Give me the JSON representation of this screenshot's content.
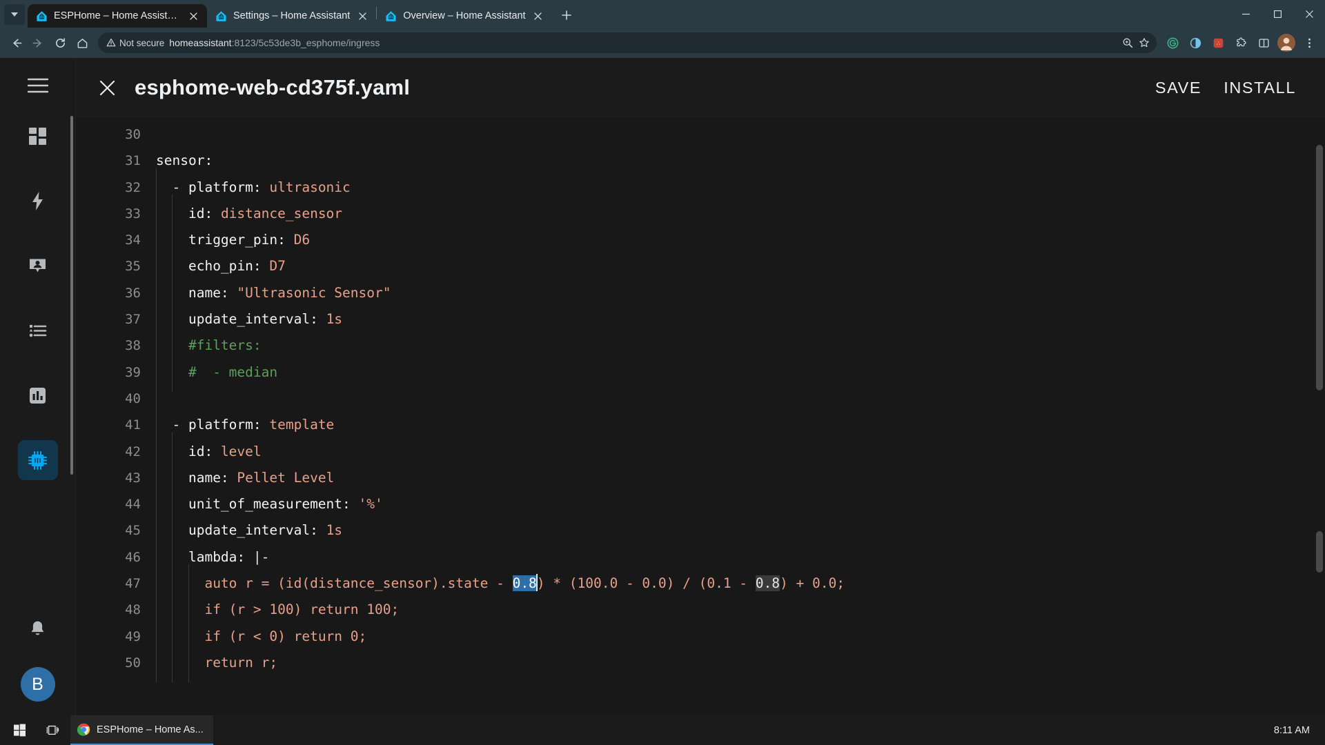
{
  "browser": {
    "tabs": [
      {
        "title": "ESPHome – Home Assistant",
        "active": true,
        "favicon": "home-assistant-icon",
        "closable": true
      },
      {
        "title": "Settings – Home Assistant",
        "active": false,
        "favicon": "home-assistant-icon",
        "closable": true
      },
      {
        "title": "Overview – Home Assistant",
        "active": false,
        "favicon": "home-assistant-icon",
        "closable": true
      }
    ],
    "tab_list_button": "tab-search-chevron",
    "new_tab_label": "+",
    "window_controls": {
      "minimize": "–",
      "maximize": "□",
      "close": "✕"
    },
    "nav": {
      "back": "back-arrow-icon",
      "forward": "forward-arrow-icon",
      "reload": "reload-icon",
      "home": "home-icon"
    },
    "omnibox": {
      "security_label": "Not secure",
      "url_host": "homeassistant",
      "url_rest": ":8123/5c53de3b_esphome/ingress",
      "zoom_icon": "zoom-in-icon",
      "bookmark_icon": "star-icon"
    },
    "toolbar_right": [
      "grammarly-icon",
      "dark-reader-icon",
      "lastpass-icon",
      "extensions-icon",
      "split-screen-icon",
      "profile-avatar",
      "more-menu-icon"
    ]
  },
  "ha_sidebar": {
    "menu_button": "hamburger-menu-icon",
    "items": [
      {
        "name": "overview",
        "icon": "view-dashboard-icon",
        "selected": false
      },
      {
        "name": "energy",
        "icon": "lightning-bolt-icon",
        "selected": false
      },
      {
        "name": "map",
        "icon": "map-marker-account-icon",
        "selected": false
      },
      {
        "name": "logbook",
        "icon": "format-list-bulleted-icon",
        "selected": false
      },
      {
        "name": "history",
        "icon": "chart-box-icon",
        "selected": false
      },
      {
        "name": "esphome",
        "icon": "chip-icon",
        "selected": true
      }
    ],
    "notifications_icon": "bell-icon",
    "user_avatar_initial": "B"
  },
  "editor": {
    "close_icon": "close-icon",
    "filename": "esphome-web-cd375f.yaml",
    "save_label": "SAVE",
    "install_label": "INSTALL",
    "first_line_number": 30,
    "lines": [
      {
        "no": 30,
        "indent": 0,
        "tokens": []
      },
      {
        "no": 31,
        "indent": 0,
        "tokens": [
          {
            "t": "sensor:",
            "c": "k"
          }
        ]
      },
      {
        "no": 32,
        "indent": 1,
        "tokens": [
          {
            "t": "- ",
            "c": "pl"
          },
          {
            "t": "platform: ",
            "c": "k"
          },
          {
            "t": "ultrasonic",
            "c": "v"
          }
        ]
      },
      {
        "no": 33,
        "indent": 2,
        "tokens": [
          {
            "t": "id: ",
            "c": "k"
          },
          {
            "t": "distance_sensor",
            "c": "v"
          }
        ]
      },
      {
        "no": 34,
        "indent": 2,
        "tokens": [
          {
            "t": "trigger_pin: ",
            "c": "k"
          },
          {
            "t": "D6",
            "c": "v"
          }
        ]
      },
      {
        "no": 35,
        "indent": 2,
        "tokens": [
          {
            "t": "echo_pin: ",
            "c": "k"
          },
          {
            "t": "D7",
            "c": "v"
          }
        ]
      },
      {
        "no": 36,
        "indent": 2,
        "tokens": [
          {
            "t": "name: ",
            "c": "k"
          },
          {
            "t": "\"Ultrasonic Sensor\"",
            "c": "v"
          }
        ]
      },
      {
        "no": 37,
        "indent": 2,
        "tokens": [
          {
            "t": "update_interval: ",
            "c": "k"
          },
          {
            "t": "1s",
            "c": "v"
          }
        ]
      },
      {
        "no": 38,
        "indent": 2,
        "tokens": [
          {
            "t": "#filters:",
            "c": "cm"
          }
        ]
      },
      {
        "no": 39,
        "indent": 2,
        "tokens": [
          {
            "t": "#  - median",
            "c": "cm"
          }
        ]
      },
      {
        "no": 40,
        "indent": 1,
        "tokens": []
      },
      {
        "no": 41,
        "indent": 1,
        "tokens": [
          {
            "t": "- ",
            "c": "pl"
          },
          {
            "t": "platform: ",
            "c": "k"
          },
          {
            "t": "template",
            "c": "v"
          }
        ]
      },
      {
        "no": 42,
        "indent": 2,
        "tokens": [
          {
            "t": "id: ",
            "c": "k"
          },
          {
            "t": "level",
            "c": "v"
          }
        ]
      },
      {
        "no": 43,
        "indent": 2,
        "tokens": [
          {
            "t": "name: ",
            "c": "k"
          },
          {
            "t": "Pellet Level",
            "c": "v"
          }
        ]
      },
      {
        "no": 44,
        "indent": 2,
        "tokens": [
          {
            "t": "unit_of_measurement: ",
            "c": "k"
          },
          {
            "t": "'%'",
            "c": "v"
          }
        ]
      },
      {
        "no": 45,
        "indent": 2,
        "tokens": [
          {
            "t": "update_interval: ",
            "c": "k"
          },
          {
            "t": "1s",
            "c": "v"
          }
        ]
      },
      {
        "no": 46,
        "indent": 2,
        "tokens": [
          {
            "t": "lambda: ",
            "c": "k"
          },
          {
            "t": "|-",
            "c": "pl"
          }
        ]
      },
      {
        "no": 47,
        "indent": 3,
        "tokens": [
          {
            "t": "auto r = (id(distance_sensor).state - ",
            "c": "v"
          },
          {
            "t": "0.8",
            "c": "sel"
          },
          {
            "t": "|",
            "c": "caret"
          },
          {
            "t": ") * (100.0 - 0.0) / (0.1 - ",
            "c": "v"
          },
          {
            "t": "0.8",
            "c": "matchhl"
          },
          {
            "t": ") + 0.0;",
            "c": "v"
          }
        ]
      },
      {
        "no": 48,
        "indent": 3,
        "tokens": [
          {
            "t": "if (r > 100) return 100;",
            "c": "v"
          }
        ]
      },
      {
        "no": 49,
        "indent": 3,
        "tokens": [
          {
            "t": "if (r < 0) return 0;",
            "c": "v"
          }
        ]
      },
      {
        "no": 50,
        "indent": 3,
        "tokens": [
          {
            "t": "return r;",
            "c": "v"
          }
        ]
      }
    ]
  },
  "taskbar": {
    "start_icon": "windows-start-icon",
    "taskview_icon": "task-view-icon",
    "task_label": "ESPHome – Home As...",
    "task_icon": "chrome-icon",
    "clock": "8:11 AM",
    "tray_clock": "8:11 AM"
  },
  "colors": {
    "chrome_frame": "#2b3b44",
    "tab_active": "#1b1b1b",
    "ha_accent": "#03a9f4",
    "sidebar_selected_bg": "#12374d",
    "editor_bg": "#181818",
    "yaml_key": "#f2f2f2",
    "yaml_value": "#e8a08a",
    "yaml_comment": "#5aa05a",
    "selection": "#2f6fa8"
  }
}
